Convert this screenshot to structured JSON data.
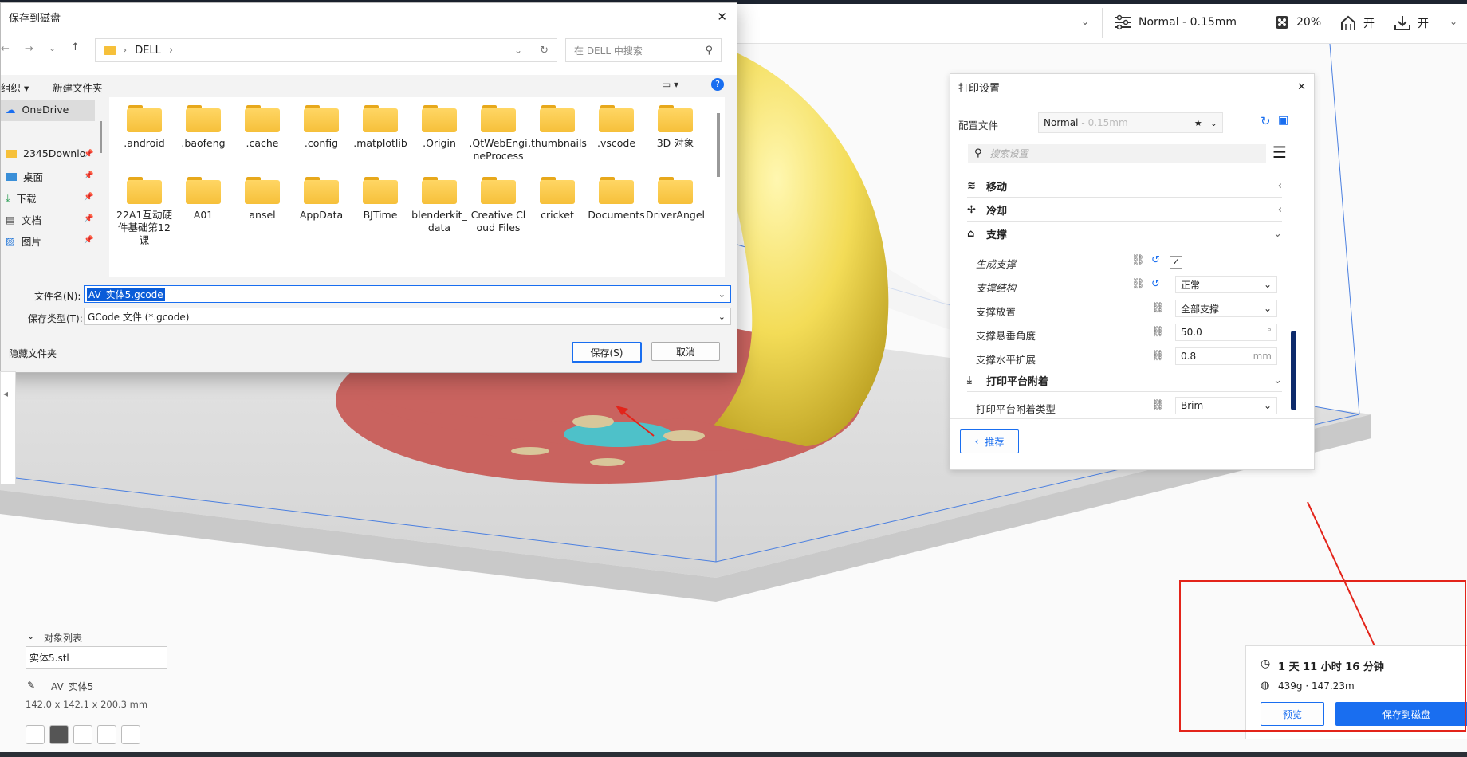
{
  "topbar": {
    "quality": "Normal - 0.15mm",
    "infill": "20%",
    "support_state": "开",
    "adhesion_state": "开"
  },
  "dialog": {
    "title": "保存到磁盘",
    "path_label": "DELL",
    "search_placeholder": "在 DELL 中搜索",
    "organize": "组织 ▾",
    "new_folder": "新建文件夹",
    "nav": [
      "OneDrive",
      "2345Downlo",
      "桌面",
      "下载",
      "文档",
      "图片"
    ],
    "folders_row1": [
      ".android",
      ".baofeng",
      ".cache",
      ".config",
      ".matplotlib",
      ".Origin",
      ".QtWebEngineProcess",
      ".thumbnails",
      ".vscode",
      "3D 对象"
    ],
    "folders_row2": [
      "22A1互动硬件基础第12课",
      "A01",
      "ansel",
      "AppData",
      "BJTime",
      "blenderkit_data",
      "Creative Cloud Files",
      "cricket",
      "Documents",
      "DriverAngel"
    ],
    "filename_label": "文件名(N):",
    "filename_value": "AV_实体5.gcode",
    "filetype_label": "保存类型(T):",
    "filetype_value": "GCode 文件 (*.gcode)",
    "hide_folders": "隐藏文件夹",
    "save_button": "保存(S)",
    "cancel_button": "取消"
  },
  "settings": {
    "title": "打印设置",
    "profile_label": "配置文件",
    "profile_value": "Normal",
    "profile_sub": "- 0.15mm",
    "search_placeholder": "搜索设置",
    "sections": [
      "移动",
      "冷却",
      "支撑",
      "打印平台附着"
    ],
    "rows": {
      "generate_support": "生成支撑",
      "support_structure": "支撑结构",
      "support_structure_value": "正常",
      "support_placement": "支撑放置",
      "support_placement_value": "全部支撑",
      "overhang_angle": "支撑悬垂角度",
      "overhang_angle_value": "50.0",
      "overhang_unit": "°",
      "horizontal_expansion": "支撑水平扩展",
      "horizontal_expansion_value": "0.8",
      "expansion_unit": "mm",
      "adhesion_type": "打印平台附着类型",
      "adhesion_type_value": "Brim"
    },
    "recommended": "推荐"
  },
  "objects": {
    "header": "对象列表",
    "item": "实体5.stl",
    "name": "AV_实体5",
    "dimensions": "142.0 x 142.1 x 200.3 mm"
  },
  "summary": {
    "time": "1 天 11 小时 16 分钟",
    "material": "439g · 147.23m",
    "preview": "预览",
    "save": "保存到磁盘"
  },
  "colors": {
    "accent": "#196ef0",
    "annotation_red": "#e3241a"
  }
}
